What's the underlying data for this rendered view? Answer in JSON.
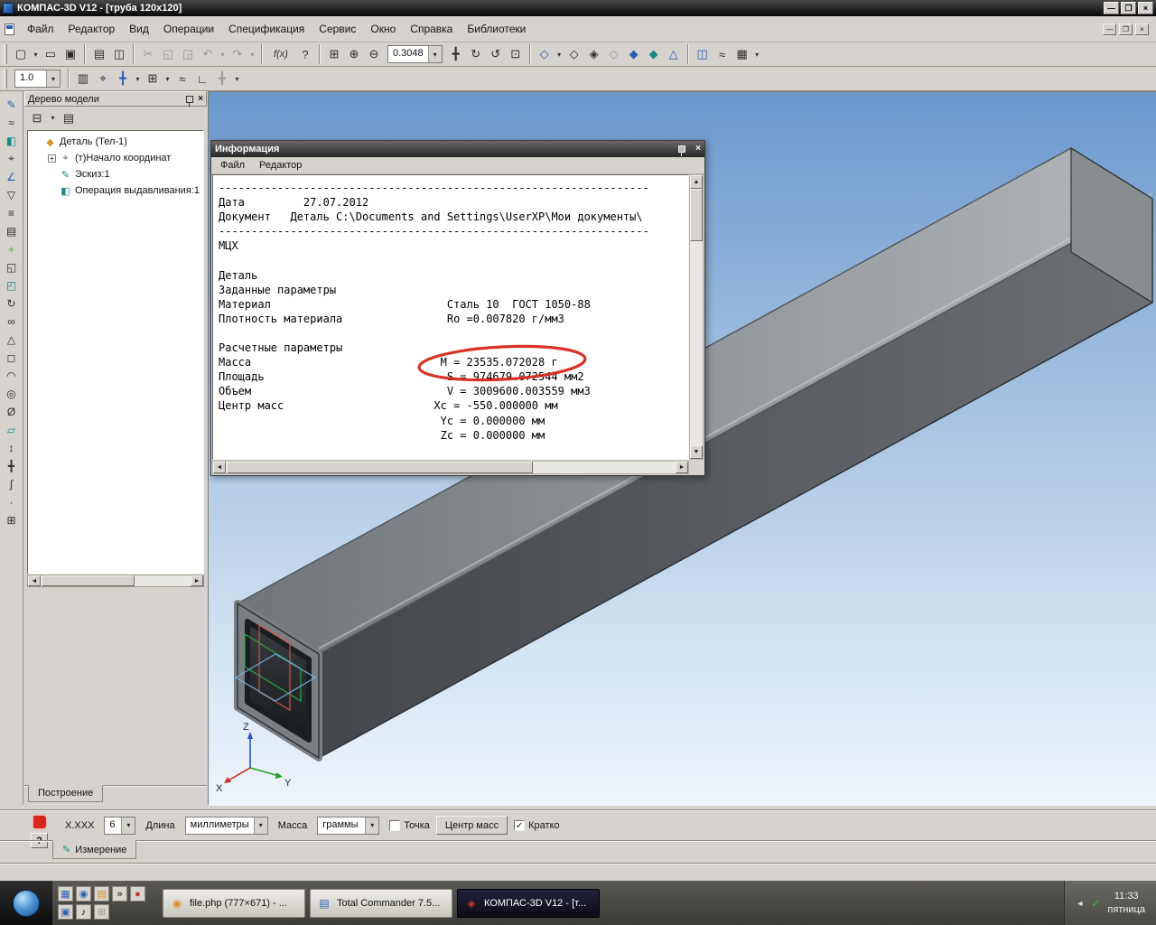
{
  "glyphs": {
    "dropdown": "▾",
    "up_arrow": "▲",
    "down_arrow": "▼",
    "left_arrow": "◄",
    "right_arrow": "►",
    "check": "✓",
    "close": "×",
    "minimize": "—",
    "restore": "❐"
  },
  "colors": {
    "annotation_red": "#d6281a",
    "viewport_top": "#6b98cc",
    "viewport_bottom": "#eef4fb",
    "tube_light": "#b2b7bb",
    "tube_dark": "#43474b",
    "accent_blue": "#2b5fb0"
  },
  "window": {
    "title": "КОМПАС-3D V12 - [труба 120x120]"
  },
  "menu": {
    "items": [
      {
        "name": "menu-file",
        "label": "Файл"
      },
      {
        "name": "menu-editor",
        "label": "Редактор"
      },
      {
        "name": "menu-view",
        "label": "Вид"
      },
      {
        "name": "menu-operations",
        "label": "Операции"
      },
      {
        "name": "menu-specification",
        "label": "Спецификация"
      },
      {
        "name": "menu-service",
        "label": "Сервис"
      },
      {
        "name": "menu-window",
        "label": "Окно"
      },
      {
        "name": "menu-help",
        "label": "Справка"
      },
      {
        "name": "menu-libraries",
        "label": "Библиотеки"
      }
    ]
  },
  "toolbar_standard": {
    "zoom_value": "0.3048",
    "group_file": [
      {
        "name": "new-document-icon",
        "glyph": "▢"
      },
      {
        "name": "new-document-arrow-icon",
        "glyph": "▾",
        "cls": "narrow"
      },
      {
        "name": "open-document-icon",
        "glyph": "▭"
      },
      {
        "name": "save-document-icon",
        "glyph": "▣"
      }
    ],
    "group_print": [
      {
        "name": "print-icon",
        "glyph": "▤"
      },
      {
        "name": "print-preview-icon",
        "glyph": "◫"
      }
    ],
    "group_clipboard": [
      {
        "name": "cut-icon",
        "glyph": "✂",
        "cls": "c-dim"
      },
      {
        "name": "copy-icon",
        "glyph": "◱",
        "cls": "c-dim"
      },
      {
        "name": "paste-icon",
        "glyph": "◲",
        "cls": "c-dim"
      },
      {
        "name": "undo-icon",
        "glyph": "↶",
        "cls": "c-dim"
      },
      {
        "name": "undo-arrow-icon",
        "glyph": "▾",
        "cls": "c-dim narrow"
      },
      {
        "name": "redo-icon",
        "glyph": "↷",
        "cls": "c-dim"
      },
      {
        "name": "redo-arrow-icon",
        "glyph": "▾",
        "cls": "c-dim narrow"
      }
    ],
    "group_tools": [
      {
        "name": "variables-icon",
        "glyph": "f(x)",
        "cls": "wide"
      },
      {
        "name": "context-help-icon",
        "glyph": "?"
      }
    ],
    "group_zoom": [
      {
        "name": "zoom-window-icon",
        "glyph": "⊞"
      },
      {
        "name": "zoom-in-icon",
        "glyph": "⊕"
      },
      {
        "name": "zoom-out-icon",
        "glyph": "⊖"
      }
    ],
    "group_nav": [
      {
        "name": "pan-icon",
        "glyph": "╋"
      },
      {
        "name": "rotate-view-icon",
        "glyph": "↻"
      },
      {
        "name": "refresh-view-icon",
        "glyph": "↺"
      },
      {
        "name": "fit-all-icon",
        "glyph": "⊡"
      }
    ],
    "group_display": [
      {
        "name": "orientation-icon",
        "glyph": "◇",
        "cls": "c-blue"
      },
      {
        "name": "orientation-arrow-icon",
        "glyph": "▾",
        "cls": "narrow"
      },
      {
        "name": "wireframe-icon",
        "glyph": "◇"
      },
      {
        "name": "hidden-lines-icon",
        "glyph": "◈"
      },
      {
        "name": "hidden-lines-thin-icon",
        "glyph": "◇",
        "cls": "c-dim"
      },
      {
        "name": "shaded-icon",
        "glyph": "◆",
        "cls": "c-blue"
      },
      {
        "name": "shaded-wireframe-icon",
        "glyph": "◆",
        "cls": "c-teal"
      },
      {
        "name": "perspective-icon",
        "glyph": "△",
        "cls": "c-blue"
      }
    ],
    "group_extra": [
      {
        "name": "section-view-icon",
        "glyph": "◫",
        "cls": "c-blue"
      },
      {
        "name": "simplify-icon",
        "glyph": "≈"
      },
      {
        "name": "macro-icon",
        "glyph": "▦"
      },
      {
        "name": "toolbar-options-arrow-icon",
        "glyph": "▾",
        "cls": "narrow"
      }
    ]
  },
  "toolbar_current": {
    "step_value": "1.0",
    "icons": [
      {
        "name": "document-properties-icon",
        "glyph": "▥"
      },
      {
        "name": "local-cs-icon",
        "glyph": "⌖"
      },
      {
        "name": "snap-settings-icon",
        "glyph": "╋",
        "cls": "c-blue"
      },
      {
        "name": "snap-arrow-icon",
        "glyph": "▾",
        "cls": "narrow"
      },
      {
        "name": "grid-icon",
        "glyph": "⊞"
      },
      {
        "name": "grid-arrow-icon",
        "glyph": "▾",
        "cls": "narrow"
      },
      {
        "name": "rounding-icon",
        "glyph": "≈"
      },
      {
        "name": "ortho-drawing-icon",
        "glyph": "∟"
      },
      {
        "name": "cursor-coordinates-icon",
        "glyph": "╋",
        "cls": "c-dim"
      },
      {
        "name": "current-options-arrow-icon",
        "glyph": "▾",
        "cls": "narrow"
      }
    ]
  },
  "compact_panel": {
    "icons": [
      {
        "name": "edit-part-icon",
        "glyph": "✎",
        "cls": "c-blue"
      },
      {
        "name": "spatial-curves-icon",
        "glyph": "≈"
      },
      {
        "name": "surfaces-icon",
        "glyph": "◧",
        "cls": "c-teal"
      },
      {
        "name": "auxiliary-geometry-icon",
        "glyph": "⌖"
      },
      {
        "name": "measurements-3d-icon",
        "glyph": "∠",
        "cls": "c-blue"
      },
      {
        "name": "filters-icon",
        "glyph": "▽"
      },
      {
        "name": "specification-icon",
        "glyph": "≡"
      },
      {
        "name": "reports-icon",
        "glyph": "▤"
      },
      {
        "name": "design-elements-icon",
        "glyph": "+",
        "cls": "c-green"
      },
      {
        "name": "sheet-body-icon",
        "glyph": "◱"
      },
      {
        "name": "extrude-icon",
        "glyph": "◰",
        "cls": "c-teal"
      },
      {
        "name": "revolve-icon",
        "glyph": "↻"
      },
      {
        "name": "loft-icon",
        "glyph": "∞"
      },
      {
        "name": "rib-icon",
        "glyph": "△"
      },
      {
        "name": "shell-icon",
        "glyph": "◻"
      },
      {
        "name": "fillet-icon",
        "glyph": "◠"
      },
      {
        "name": "hole-icon",
        "glyph": "◎"
      },
      {
        "name": "thread-icon",
        "glyph": "Ø"
      },
      {
        "name": "plane-icon",
        "glyph": "▱",
        "cls": "c-teal"
      },
      {
        "name": "axis-icon",
        "glyph": "↕"
      },
      {
        "name": "coordinate-system-icon",
        "glyph": "╋"
      },
      {
        "name": "spline-icon",
        "glyph": "∫"
      },
      {
        "name": "point-icon",
        "glyph": "·"
      },
      {
        "name": "array-icon",
        "glyph": "⊞"
      }
    ]
  },
  "model_tree": {
    "title": "Дерево модели",
    "toolbar": [
      {
        "name": "tree-structure-icon",
        "glyph": "⊟"
      },
      {
        "name": "tree-structure-arrow-icon",
        "glyph": "▾",
        "cls": "narrow"
      },
      {
        "name": "tree-composition-icon",
        "glyph": "▤"
      }
    ],
    "items": [
      {
        "name": "tree-item-part",
        "label": "Деталь (Тел-1)",
        "glyph": "◆",
        "cls": "c-orange",
        "level_cls": "lvl0",
        "expander": ""
      },
      {
        "name": "tree-item-origin",
        "label": "(т)Начало координат",
        "glyph": "⌖",
        "cls": "c-slate",
        "level_cls": "lvl1",
        "expander": "+"
      },
      {
        "name": "tree-item-sketch",
        "label": "Эскиз:1",
        "glyph": "✎",
        "cls": "c-teal",
        "level_cls": "lvl1",
        "expander": ""
      },
      {
        "name": "tree-item-extrusion",
        "label": "Операция выдавливания:1",
        "glyph": "◧",
        "cls": "c-teal",
        "level_cls": "lvl1",
        "expander": ""
      }
    ],
    "bottom_tab": "Построение"
  },
  "viewport": {
    "axes": {
      "x": "X",
      "y": "Y",
      "z": "Z"
    }
  },
  "info_window": {
    "title": "Информация",
    "menu": [
      {
        "name": "info-menu-file",
        "label": "Файл"
      },
      {
        "name": "info-menu-editor",
        "label": "Редактор"
      }
    ],
    "content": "------------------------------------------------------------------\nДата         27.07.2012\nДокумент   Деталь C:\\Documents and Settings\\UserXP\\Мои документы\\\n------------------------------------------------------------------\nМЦХ\n\nДеталь\nЗаданные параметры\nМатериал                           Сталь 10  ГОСТ 1050-88\nПлотность материала                Ro =0.007820 г/мм3\n\nРасчетные параметры\nМасса                             М = 23535.072028 г\nПлощадь                            S = 974679.072544 мм2\nОбъем                              V = 3009600.003559 мм3\nЦентр масс                       Xc = -550.000000 мм\n                                  Yc = 0.000000 мм\n                                  Zc = 0.000000 мм"
  },
  "measure_panel": {
    "help_label": "?",
    "precision_label": "X.XXX",
    "precision_value": "6",
    "length_label": "Длина",
    "length_unit": "миллиметры",
    "mass_label": "Масса",
    "mass_unit": "граммы",
    "point_label": "Точка",
    "point_check": "",
    "center_mass_button": "Центр масс",
    "brief_label": "Кратко",
    "brief_check": "✓",
    "tab_label": "Измерение",
    "tab_icon": "✎"
  },
  "taskbar": {
    "quick_launch": [
      {
        "name": "show-desktop-icon",
        "glyph": "▦",
        "cls": "c-blue"
      },
      {
        "name": "browser-quicklaunch-icon",
        "glyph": "◉",
        "cls": "c-blue"
      },
      {
        "name": "folder-quicklaunch-icon",
        "glyph": "▤",
        "cls": "c-orange"
      },
      {
        "name": "chevron-expand-icon",
        "glyph": "»"
      },
      {
        "name": "office-quicklaunch-icon",
        "glyph": "●",
        "cls": "c-red"
      },
      {
        "name": "save-quicklaunch-icon",
        "glyph": "▣",
        "cls": "c-blue"
      },
      {
        "name": "media-quicklaunch-icon",
        "glyph": "♪"
      },
      {
        "name": "calculator-quicklaunch-icon",
        "glyph": "⊞",
        "cls": "c-dim"
      }
    ],
    "task_buttons": [
      {
        "name": "taskbar-button-filephp",
        "label": "file.php (777×671) - ...",
        "state": "normal",
        "glyph": "◉",
        "icon_cls": "c-orange"
      },
      {
        "name": "taskbar-button-totalcommander",
        "label": "Total Commander 7.5...",
        "state": "normal",
        "glyph": "▤",
        "icon_cls": "c-blue"
      },
      {
        "name": "taskbar-button-kompas",
        "label": "КОМПАС-3D V12 - [т...",
        "state": "active",
        "glyph": "◈",
        "icon_cls": "c-red"
      }
    ],
    "tray": {
      "time": "11:33",
      "day": "пятница"
    }
  }
}
